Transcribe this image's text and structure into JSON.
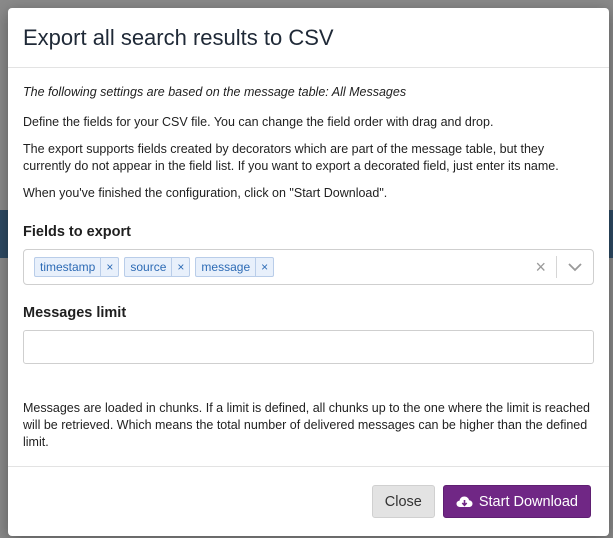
{
  "modal": {
    "title": "Export all search results to CSV",
    "intro": "The following settings are based on the message table: All Messages",
    "paragraphs": [
      "Define the fields for your CSV file. You can change the field order with drag and drop.",
      "The export supports fields created by decorators which are part of the message table, but they currently do not appear in the field list. If you want to export a decorated field, just enter its name.",
      "When you've finished the configuration, click on \"Start Download\"."
    ],
    "fields_label": "Fields to export",
    "fields": [
      {
        "label": "timestamp",
        "remove": "×"
      },
      {
        "label": "source",
        "remove": "×"
      },
      {
        "label": "message",
        "remove": "×"
      }
    ],
    "clear_all": "×",
    "limit_label": "Messages limit",
    "limit_value": "",
    "limit_help": "Messages are loaded in chunks. If a limit is defined, all chunks up to the one where the limit is reached will be retrieved. Which means the total number of delivered messages can be higher than the defined limit.",
    "close_label": "Close",
    "download_label": "Start Download",
    "colors": {
      "primary": "#702785",
      "chip_bg": "#e8f0fb",
      "chip_text": "#2d6bb5"
    },
    "icons": {
      "download": "cloud-download-icon",
      "dropdown": "chevron-down-icon"
    }
  }
}
